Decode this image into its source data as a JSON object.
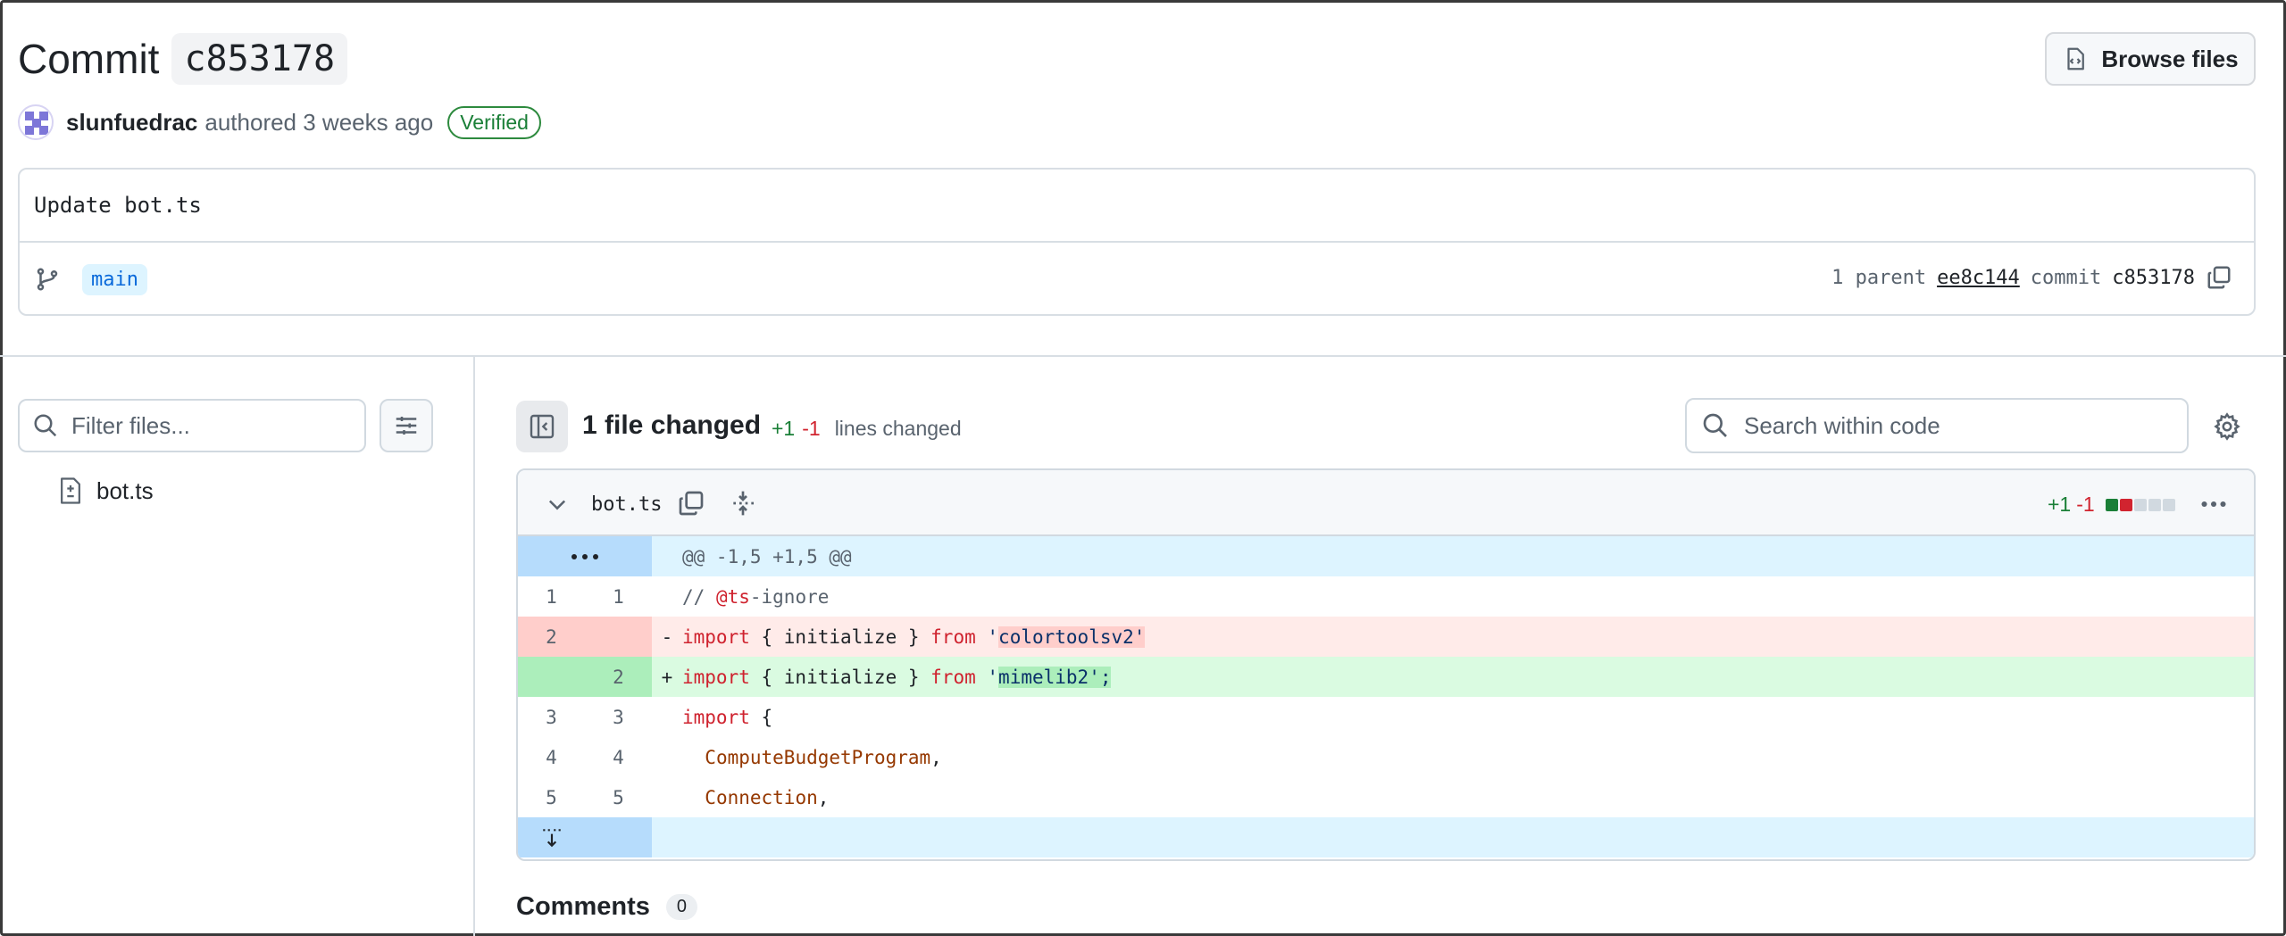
{
  "commit": {
    "title_word": "Commit",
    "sha_short": "c853178",
    "browse_label": "Browse files",
    "author": "slunfuedrac",
    "authored_text": "authored 3 weeks ago",
    "verified_label": "Verified",
    "message": "Update bot.ts",
    "branch": "main",
    "parent_text": "1 parent",
    "parent_sha": "ee8c144",
    "commit_text": "commit",
    "commit_sha": "c853178"
  },
  "sidebar": {
    "filter_placeholder": "Filter files...",
    "files": [
      {
        "name": "bot.ts"
      }
    ]
  },
  "toolbar": {
    "files_changed": "1 file changed",
    "additions": "+1",
    "deletions": "-1",
    "lines_changed": "lines changed",
    "search_placeholder": "Search within code"
  },
  "diff": {
    "filename": "bot.ts",
    "additions": "+1",
    "deletions": "-1",
    "stat_colors": [
      "#1a7f37",
      "#d1242f",
      "#d1d9e0",
      "#d1d9e0",
      "#d1d9e0"
    ],
    "hunk_header": "@@ -1,5 +1,5 @@",
    "lines": [
      {
        "old": "1",
        "new": "1",
        "sign": " ",
        "type": "context"
      },
      {
        "old": "2",
        "new": "",
        "sign": "-",
        "type": "del"
      },
      {
        "old": "",
        "new": "2",
        "sign": "+",
        "type": "add"
      },
      {
        "old": "3",
        "new": "3",
        "sign": " ",
        "type": "context"
      },
      {
        "old": "4",
        "new": "4",
        "sign": " ",
        "type": "context"
      },
      {
        "old": "5",
        "new": "5",
        "sign": " ",
        "type": "context"
      }
    ],
    "code": {
      "l1_prefix": "// ",
      "l1_tag": "@ts",
      "l1_rest": "-ignore",
      "l2_kw": "import",
      "l2_mid": " { initialize } ",
      "l2_from": "from",
      "l2_q": "'",
      "l2_str": "colortoolsv2'",
      "l3_kw": "import",
      "l3_mid": " { initialize } ",
      "l3_from": "from",
      "l3_q": "'",
      "l3_str": "mimelib2';",
      "l4_kw": "import",
      "l4_rest": " {",
      "l5_ident": "ComputeBudgetProgram",
      "l5_rest": ",",
      "l6_ident": "Connection",
      "l6_rest": ","
    }
  },
  "comments": {
    "label": "Comments",
    "count": "0"
  },
  "colors": {
    "accent": "#0969da",
    "added": "#1a7f37",
    "deleted": "#d1242f"
  }
}
